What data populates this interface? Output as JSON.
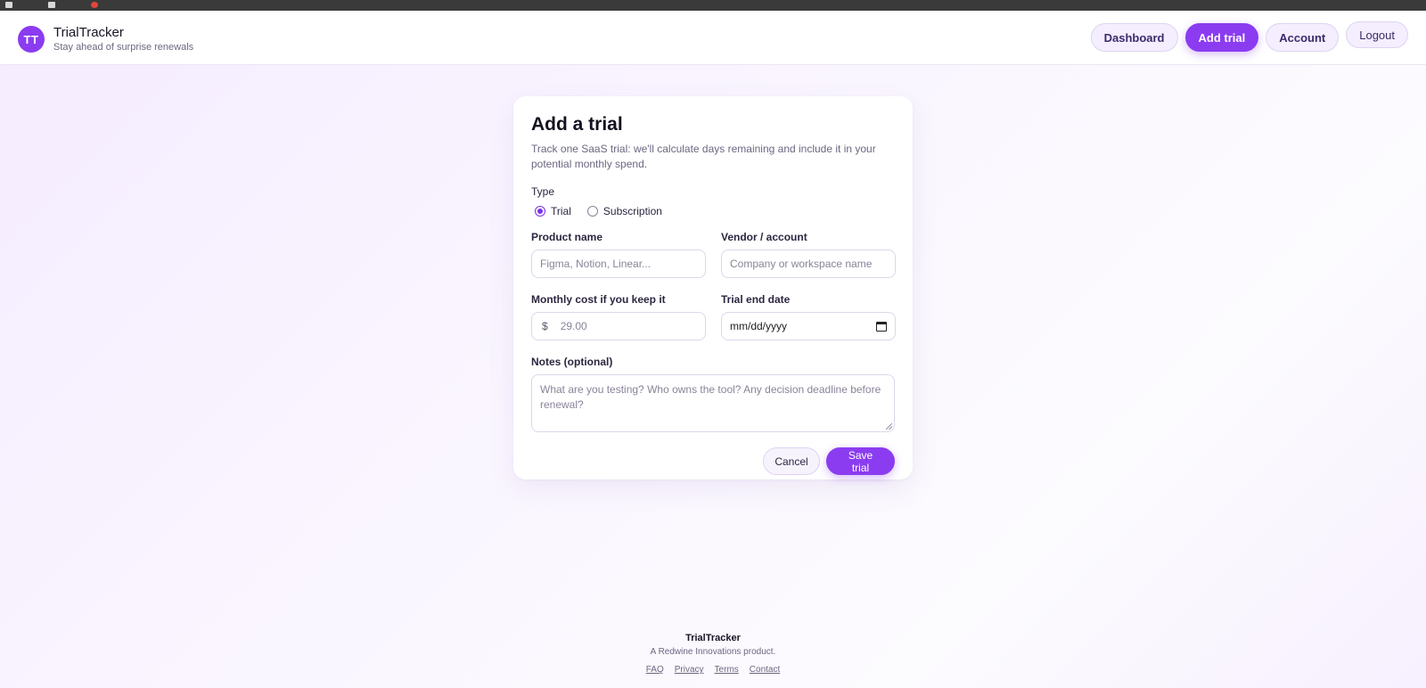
{
  "app": {
    "avatar_initials": "TT",
    "name": "TrialTracker",
    "tagline": "Stay ahead of surprise renewals",
    "accent_color": "#8b3cf0"
  },
  "nav": {
    "dashboard": "Dashboard",
    "add_trial": "Add trial",
    "account": "Account",
    "logout": "Logout",
    "active": "add_trial"
  },
  "form": {
    "title": "Add a trial",
    "subtitle": "Track one SaaS trial: we'll calculate days remaining and include it in your potential monthly spend.",
    "type_label": "Type",
    "type_options": [
      "Trial",
      "Subscription"
    ],
    "type_selected": "Trial",
    "product_label": "Product name",
    "product_placeholder": "Figma, Notion, Linear...",
    "vendor_label": "Vendor / account",
    "vendor_placeholder": "Company or workspace name",
    "cost_label": "Monthly cost if you keep it",
    "currency_symbol": "$",
    "cost_placeholder": "29.00",
    "end_date_label": "Trial end date",
    "end_date_placeholder": "mm/dd/yyyy",
    "notes_label": "Notes (optional)",
    "notes_placeholder": "What are you testing? Who owns the tool? Any decision deadline before renewal?",
    "cancel_label": "Cancel",
    "save_label": "Save trial"
  },
  "footer": {
    "name": "TrialTracker",
    "tagline": "A Redwine Innovations product.",
    "links": [
      "FAQ",
      "Privacy",
      "Terms",
      "Contact"
    ]
  }
}
